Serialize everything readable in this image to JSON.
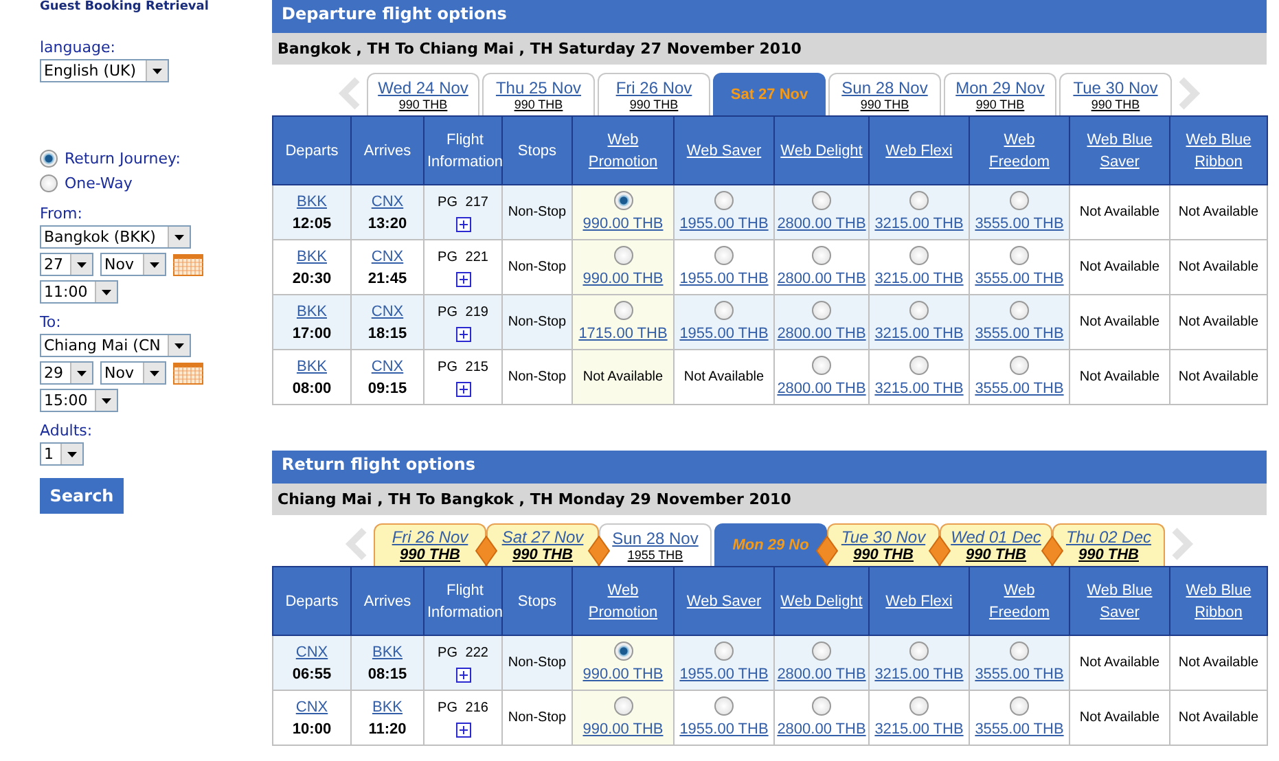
{
  "sidebar": {
    "title": "Guest Booking Retrieval",
    "language_label": "language:",
    "language": "English (UK)",
    "journey": [
      {
        "label": "Return Journey:",
        "selected": true
      },
      {
        "label": "One-Way",
        "selected": false
      }
    ],
    "from": {
      "label": "From:",
      "place": "Bangkok (BKK)",
      "day": "27",
      "month": "Nov",
      "time": "11:00"
    },
    "to": {
      "label": "To:",
      "place": "Chiang Mai (CN",
      "day": "29",
      "month": "Nov",
      "time": "15:00"
    },
    "adults_label": "Adults:",
    "adults": "1",
    "search": "Search"
  },
  "sections": [
    {
      "title": "Departure flight options",
      "route": "Bangkok , TH To Chiang Mai , TH Saturday 27 November 2010",
      "tabs": [
        {
          "day": "Wed 24 Nov",
          "price": "990 THB",
          "kind": "plain",
          "selected": false
        },
        {
          "day": "Thu 25 Nov",
          "price": "990 THB",
          "kind": "plain",
          "selected": false
        },
        {
          "day": "Fri 26 Nov",
          "price": "990 THB",
          "kind": "plain",
          "selected": false
        },
        {
          "day": "Sat 27 Nov",
          "kind": "plain",
          "selected": true
        },
        {
          "day": "Sun 28 Nov",
          "price": "990 THB",
          "kind": "plain",
          "selected": false
        },
        {
          "day": "Mon 29 Nov",
          "price": "990 THB",
          "kind": "plain",
          "selected": false
        },
        {
          "day": "Tue 30 Nov",
          "price": "990 THB",
          "kind": "plain",
          "selected": false
        }
      ],
      "columns": [
        {
          "label": "Departs",
          "kind": "text"
        },
        {
          "label": "Arrives",
          "kind": "text"
        },
        {
          "label": "Flight Information",
          "kind": "text"
        },
        {
          "label": "Stops",
          "kind": "text"
        },
        {
          "label": "Web Promotion",
          "kind": "link"
        },
        {
          "label": "Web Saver",
          "kind": "link"
        },
        {
          "label": "Web Delight",
          "kind": "link"
        },
        {
          "label": "Web Flexi",
          "kind": "link"
        },
        {
          "label": "Web Freedom",
          "kind": "link"
        },
        {
          "label": "Web Blue Saver",
          "kind": "link"
        },
        {
          "label": "Web Blue Ribbon",
          "kind": "link"
        }
      ],
      "rows": [
        {
          "from": "BKK",
          "departs": "12:05",
          "to": "CNX",
          "arrives": "13:20",
          "flight": "PG 217",
          "stops": "Non-Stop",
          "fares": [
            {
              "kind": "radio",
              "price": "990.00 THB",
              "selected": true
            },
            {
              "kind": "radio",
              "price": "1955.00 THB",
              "selected": false
            },
            {
              "kind": "radio",
              "price": "2800.00 THB",
              "selected": false
            },
            {
              "kind": "radio",
              "price": "3215.00 THB",
              "selected": false
            },
            {
              "kind": "radio",
              "price": "3555.00 THB",
              "selected": false
            },
            {
              "kind": "none",
              "text": "Not Available"
            },
            {
              "kind": "none",
              "text": "Not Available"
            }
          ]
        },
        {
          "from": "BKK",
          "departs": "20:30",
          "to": "CNX",
          "arrives": "21:45",
          "flight": "PG 221",
          "stops": "Non-Stop",
          "fares": [
            {
              "kind": "radio",
              "price": "990.00 THB",
              "selected": false
            },
            {
              "kind": "radio",
              "price": "1955.00 THB",
              "selected": false
            },
            {
              "kind": "radio",
              "price": "2800.00 THB",
              "selected": false
            },
            {
              "kind": "radio",
              "price": "3215.00 THB",
              "selected": false
            },
            {
              "kind": "radio",
              "price": "3555.00 THB",
              "selected": false
            },
            {
              "kind": "none",
              "text": "Not Available"
            },
            {
              "kind": "none",
              "text": "Not Available"
            }
          ]
        },
        {
          "from": "BKK",
          "departs": "17:00",
          "to": "CNX",
          "arrives": "18:15",
          "flight": "PG 219",
          "stops": "Non-Stop",
          "fares": [
            {
              "kind": "radio",
              "price": "1715.00 THB",
              "selected": false
            },
            {
              "kind": "radio",
              "price": "1955.00 THB",
              "selected": false
            },
            {
              "kind": "radio",
              "price": "2800.00 THB",
              "selected": false
            },
            {
              "kind": "radio",
              "price": "3215.00 THB",
              "selected": false
            },
            {
              "kind": "radio",
              "price": "3555.00 THB",
              "selected": false
            },
            {
              "kind": "none",
              "text": "Not Available"
            },
            {
              "kind": "none",
              "text": "Not Available"
            }
          ]
        },
        {
          "from": "BKK",
          "departs": "08:00",
          "to": "CNX",
          "arrives": "09:15",
          "flight": "PG 215",
          "stops": "Non-Stop",
          "fares": [
            {
              "kind": "none",
              "text": "Not Available"
            },
            {
              "kind": "none",
              "text": "Not Available"
            },
            {
              "kind": "radio",
              "price": "2800.00 THB",
              "selected": false
            },
            {
              "kind": "radio",
              "price": "3215.00 THB",
              "selected": false
            },
            {
              "kind": "radio",
              "price": "3555.00 THB",
              "selected": false
            },
            {
              "kind": "none",
              "text": "Not Available"
            },
            {
              "kind": "none",
              "text": "Not Available"
            }
          ]
        }
      ]
    },
    {
      "title": "Return flight options",
      "route": "Chiang Mai , TH To Bangkok , TH Monday 29 November 2010",
      "tabs": [
        {
          "day": "Fri 26 Nov",
          "price": "990 THB",
          "kind": "promo",
          "selected": false
        },
        {
          "day": "Sat 27 Nov",
          "price": "990 THB",
          "kind": "promo",
          "selected": false
        },
        {
          "day": "Sun 28 Nov",
          "price": "1955 THB",
          "kind": "plain",
          "selected": false
        },
        {
          "day": "Mon 29 No",
          "kind": "promo",
          "selected": true
        },
        {
          "day": "Tue 30 Nov",
          "price": "990 THB",
          "kind": "promo",
          "selected": false
        },
        {
          "day": "Wed 01 Dec",
          "price": "990 THB",
          "kind": "promo",
          "selected": false
        },
        {
          "day": "Thu 02 Dec",
          "price": "990 THB",
          "kind": "promo",
          "selected": false
        }
      ],
      "columns": [
        {
          "label": "Departs",
          "kind": "text"
        },
        {
          "label": "Arrives",
          "kind": "text"
        },
        {
          "label": "Flight Information",
          "kind": "text"
        },
        {
          "label": "Stops",
          "kind": "text"
        },
        {
          "label": "Web Promotion",
          "kind": "link"
        },
        {
          "label": "Web Saver",
          "kind": "link"
        },
        {
          "label": "Web Delight",
          "kind": "link"
        },
        {
          "label": "Web Flexi",
          "kind": "link"
        },
        {
          "label": "Web Freedom",
          "kind": "link"
        },
        {
          "label": "Web Blue Saver",
          "kind": "link"
        },
        {
          "label": "Web Blue Ribbon",
          "kind": "link"
        }
      ],
      "rows": [
        {
          "from": "CNX",
          "departs": "06:55",
          "to": "BKK",
          "arrives": "08:15",
          "flight": "PG 222",
          "stops": "Non-Stop",
          "fares": [
            {
              "kind": "radio",
              "price": "990.00 THB",
              "selected": true
            },
            {
              "kind": "radio",
              "price": "1955.00 THB",
              "selected": false
            },
            {
              "kind": "radio",
              "price": "2800.00 THB",
              "selected": false
            },
            {
              "kind": "radio",
              "price": "3215.00 THB",
              "selected": false
            },
            {
              "kind": "radio",
              "price": "3555.00 THB",
              "selected": false
            },
            {
              "kind": "none",
              "text": "Not Available"
            },
            {
              "kind": "none",
              "text": "Not Available"
            }
          ]
        },
        {
          "from": "CNX",
          "departs": "10:00",
          "to": "BKK",
          "arrives": "11:20",
          "flight": "PG 216",
          "stops": "Non-Stop",
          "fares": [
            {
              "kind": "radio",
              "price": "990.00 THB",
              "selected": false
            },
            {
              "kind": "radio",
              "price": "1955.00 THB",
              "selected": false
            },
            {
              "kind": "radio",
              "price": "2800.00 THB",
              "selected": false
            },
            {
              "kind": "radio",
              "price": "3215.00 THB",
              "selected": false
            },
            {
              "kind": "radio",
              "price": "3555.00 THB",
              "selected": false
            },
            {
              "kind": "none",
              "text": "Not Available"
            },
            {
              "kind": "none",
              "text": "Not Available"
            }
          ]
        }
      ]
    }
  ]
}
